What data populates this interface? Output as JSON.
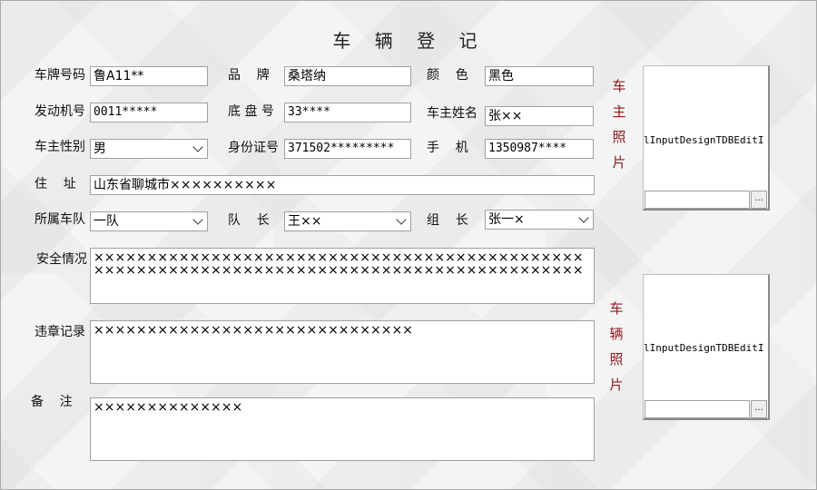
{
  "title": "车 辆 登 记",
  "labels": {
    "plate": "车牌号码",
    "brand": "品    牌",
    "color": "颜    色",
    "engine": "发动机号",
    "chassis": "底 盘 号",
    "owner_name": "车主姓名",
    "owner_gender": "车主性别",
    "id_number": "身份证号",
    "phone": "手    机",
    "address": "住    址",
    "team": "所属车队",
    "captain": "队    长",
    "group_leader": "组    长",
    "safety": "安全情况",
    "violations": "违章记录",
    "remarks": "备    注"
  },
  "values": {
    "plate": "鲁A11**",
    "brand": "桑塔纳",
    "color": "黑色",
    "engine": "0011*****",
    "chassis": "33****",
    "owner_name": "张××",
    "owner_gender": "男",
    "id_number": "371502*********",
    "phone": "1350987****",
    "address": "山东省聊城市××××××××××",
    "team": "一队",
    "captain": "王××",
    "group_leader": "张一×",
    "safety": "××××××××××××××××××××××××××××××××××××××××××××××××××××××××××××××××××××××××××××××××××××××××××××",
    "violations": "××××××××××××××××××××××××××××××",
    "remarks": "××××××××××××××"
  },
  "photos": {
    "owner": {
      "label": "车主照片",
      "control_text": "lInputDesignTDBEditI",
      "button": "…"
    },
    "vehicle": {
      "label": "车辆照片",
      "control_text": "lInputDesignTDBEditI",
      "button": "…"
    }
  }
}
